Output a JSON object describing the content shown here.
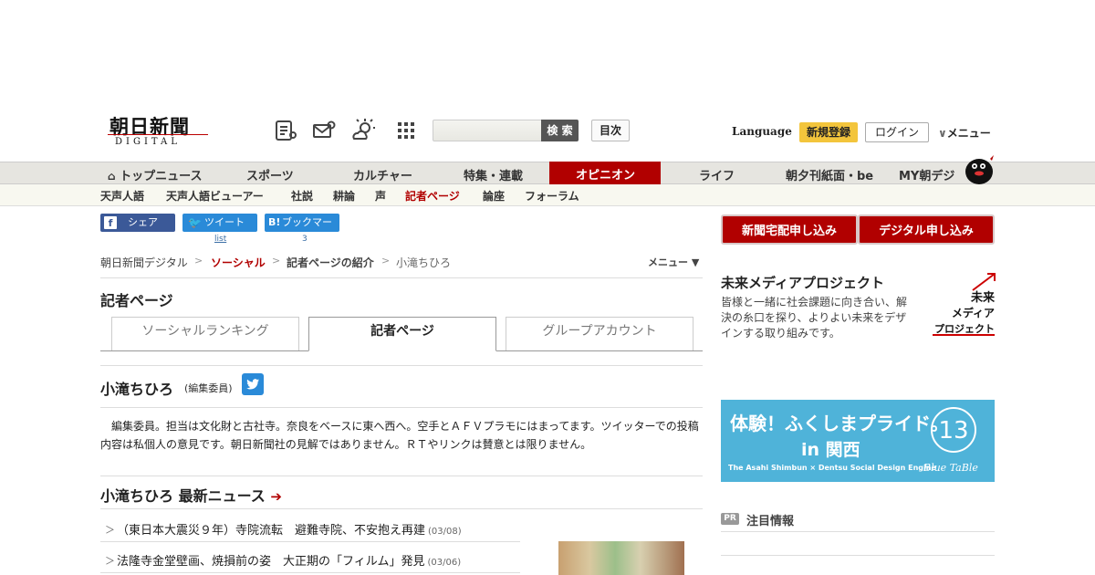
{
  "header": {
    "logo_main": "朝日新聞",
    "logo_sub": "DIGITAL",
    "icons": [
      "paper-list-icon",
      "mail-icon",
      "weather-icon",
      "grid-icon"
    ],
    "search_placeholder": "",
    "search_button": "検 索",
    "toc_button": "目次",
    "language": "Language",
    "register": "新規登録",
    "login": "ログイン",
    "menu": "メニュー"
  },
  "nav": {
    "main": [
      "トップニュース",
      "スポーツ",
      "カルチャー",
      "特集・連載",
      "オピニオン",
      "ライフ",
      "朝夕刊紙面・be",
      "MY朝デジ"
    ],
    "active": "オピニオン",
    "sub": [
      "天声人語",
      "天声人語ビューアー",
      "社説",
      "耕論",
      "声",
      "記者ページ",
      "論座",
      "フォーラム"
    ],
    "sub_active": "記者ページ"
  },
  "share": {
    "facebook": "シェア",
    "twitter": "ツイート",
    "twitter_count": "list",
    "hatena": "ブックマーク",
    "hatena_count": "3"
  },
  "breadcrumb": {
    "items": [
      "朝日新聞デジタル",
      "ソーシャル",
      "記者ページの紹介",
      "小滝ちひろ"
    ],
    "sep": ">",
    "menu": "メニュー ▼"
  },
  "page": {
    "heading": "記者ページ",
    "tabs": [
      "ソーシャルランキング",
      "記者ページ",
      "グループアカウント"
    ],
    "active_tab": "記者ページ"
  },
  "profile": {
    "name": "小滝ちひろ",
    "role": "(編集委員)",
    "bio": "編集委員。担当は文化財と古社寺。奈良をベースに東へ西へ。空手とＡＦＶプラモにはまってます。ツイッターでの投稿内容は私個人の意見です。朝日新聞社の見解ではありません。ＲＴやリンクは賛意とは限りません。"
  },
  "latest": {
    "heading": "小滝ちひろ 最新ニュース",
    "items": [
      {
        "title": "（東日本大震災９年）寺院流転　避難寺院、不安抱え再建",
        "date": "(03/08)"
      },
      {
        "title": "法隆寺金堂壁画、焼損前の姿　大正期の「フィルム」発見",
        "date": "(03/06)"
      }
    ]
  },
  "sidebar": {
    "btn_paper": "新聞宅配申し込み",
    "btn_digital": "デジタル申し込み",
    "mm_title": "未来メディアプロジェクト",
    "mm_text": "皆様と一緒に社会課題に向き合い、解決の糸口を探り、よりよい未来をデザインする取り組みです。",
    "mm_logo": "未来メディアプロジェクト",
    "ad_title": "体験！ふくしまプライド。",
    "ad_sub": "in 関西",
    "ad_credit": "The Asahi Shimbun × Dentsu Social Design Engine",
    "ad_brand": "Blue TaBle",
    "pr_badge": "PR",
    "pr_text": "注目情報"
  },
  "colors": {
    "accent": "#b10000",
    "nav_bg": "#e6e5e0",
    "twitter": "#2a8ad8",
    "facebook": "#3b5998",
    "ad_bg": "#4fb3d9"
  }
}
